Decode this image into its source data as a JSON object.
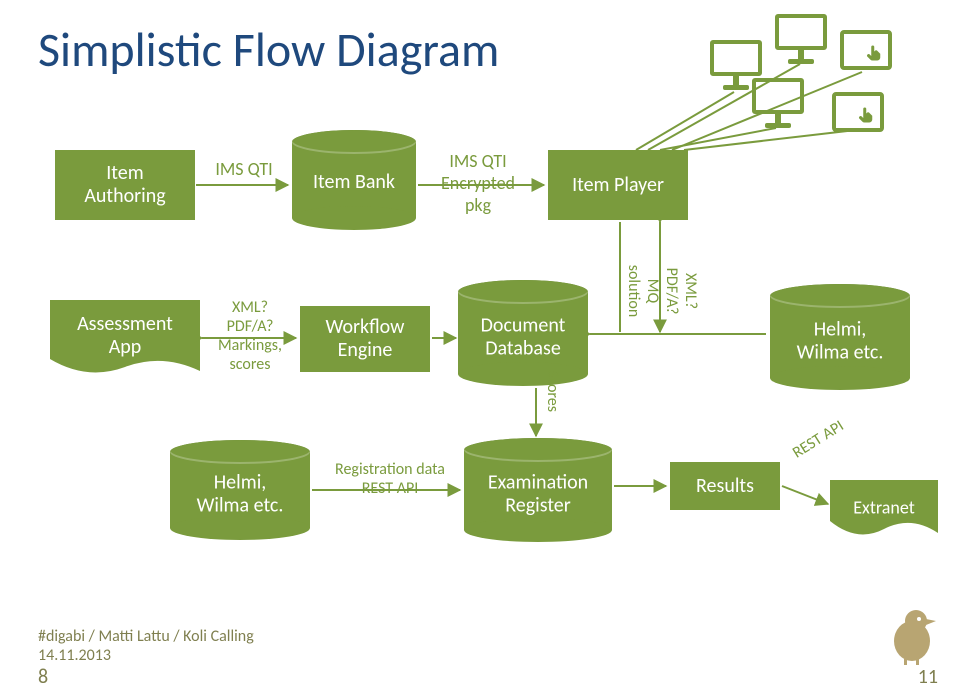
{
  "title": "Simplistic Flow Diagram",
  "nodes": {
    "item_authoring": "Item\nAuthoring",
    "item_bank": "Item Bank",
    "item_player": "Item Player",
    "assessment_app": "Assessment\nApp",
    "workflow_engine": "Workflow\nEngine",
    "document_database": "Document\nDatabase",
    "helmi1": "Helmi,\nWilma etc.",
    "helmi2": "Helmi,\nWilma etc.",
    "exam_register": "Examination\nRegister",
    "results": "Results",
    "extranet": "Extranet"
  },
  "edges": {
    "ims_qti_1": "IMS QTI",
    "ims_qti_pkg": "IMS QTI\nEncrypted\npkg",
    "xml_pdfa_marks": "XML?\nPDF/A?\nMarkings,\nscores",
    "scores": "Scores",
    "mq_solution": "MQ\nsolution",
    "xml_pdfa": "XML?\nPDF/A?",
    "reg_data": "Registration data\nREST API",
    "rest_api": "REST API"
  },
  "footer": {
    "line1": "#digabi / Matti Lattu / Koli Calling",
    "line2": "14.11.2013",
    "page_left": "8",
    "page_right": "11"
  }
}
